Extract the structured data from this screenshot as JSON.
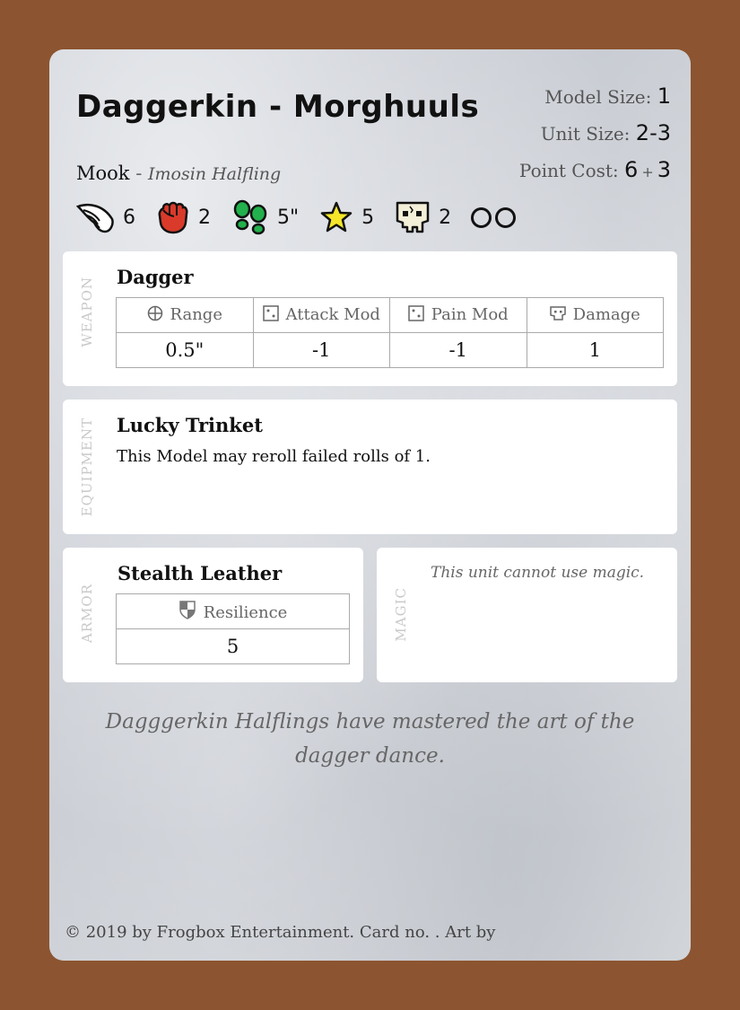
{
  "header": {
    "title": "Daggerkin - Morghuuls",
    "model_size_label": "Model Size:",
    "model_size": "1",
    "unit_size_label": "Unit Size:",
    "unit_size": "2-3",
    "point_cost_label": "Point Cost:",
    "point_cost_base": "6",
    "point_cost_plus": "+",
    "point_cost_extra": "3",
    "type": "Mook",
    "type_sep": "-",
    "race": "Imosin Halfling"
  },
  "attributes": [
    {
      "icon": "wing-icon",
      "value": "6"
    },
    {
      "icon": "fist-icon",
      "value": "2"
    },
    {
      "icon": "footprints-icon",
      "value": "5\""
    },
    {
      "icon": "star-icon",
      "value": "5"
    },
    {
      "icon": "skull-icon",
      "value": "2"
    }
  ],
  "weapon": {
    "label": "WEAPON",
    "name": "Dagger",
    "headers": [
      "Range",
      "Attack Mod",
      "Pain Mod",
      "Damage"
    ],
    "values": [
      "0.5\"",
      "-1",
      "-1",
      "1"
    ]
  },
  "equipment": {
    "label": "EQUIPMENT",
    "name": "Lucky Trinket",
    "description": "This Model may reroll failed rolls of 1."
  },
  "armor": {
    "label": "ARMOR",
    "name": "Stealth Leather",
    "header": "Resilience",
    "value": "5"
  },
  "magic": {
    "label": "MAGIC",
    "note": "This unit cannot use magic."
  },
  "flavor": "Dagggerkin Halflings have mastered the art of the dagger dance.",
  "footer": "© 2019 by Frogbox Entertainment. Card no. . Art by",
  "colors": {
    "border": "#8c5430",
    "fist": "#d93a2a",
    "footprints": "#22b14c",
    "star": "#f5e62a"
  }
}
